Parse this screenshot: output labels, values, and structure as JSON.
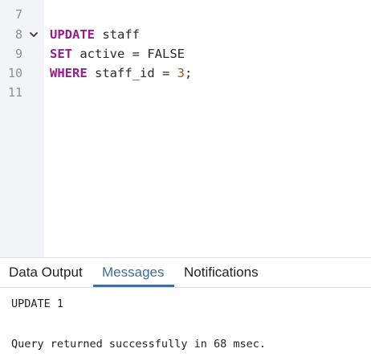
{
  "editor": {
    "line_numbers": [
      "7",
      "8",
      "9",
      "10",
      "11"
    ],
    "lines": [
      {
        "kw": "UPDATE",
        "rest": " staff"
      },
      {
        "kw": "SET",
        "rest": " active = FALSE"
      },
      {
        "kw": "WHERE",
        "rest": " staff_id = ",
        "num": "3",
        "end": ";"
      }
    ]
  },
  "tabs": [
    {
      "label": "Data Output"
    },
    {
      "label": "Messages"
    },
    {
      "label": "Notifications"
    }
  ],
  "messages": {
    "line1": "UPDATE 1",
    "line2": "Query returned successfully in 68 msec."
  },
  "colors": {
    "keyword": "#9c1a8f",
    "number": "#a8531e",
    "active_tab": "#3d6e99"
  },
  "icons": [
    "chevron-down-icon"
  ]
}
